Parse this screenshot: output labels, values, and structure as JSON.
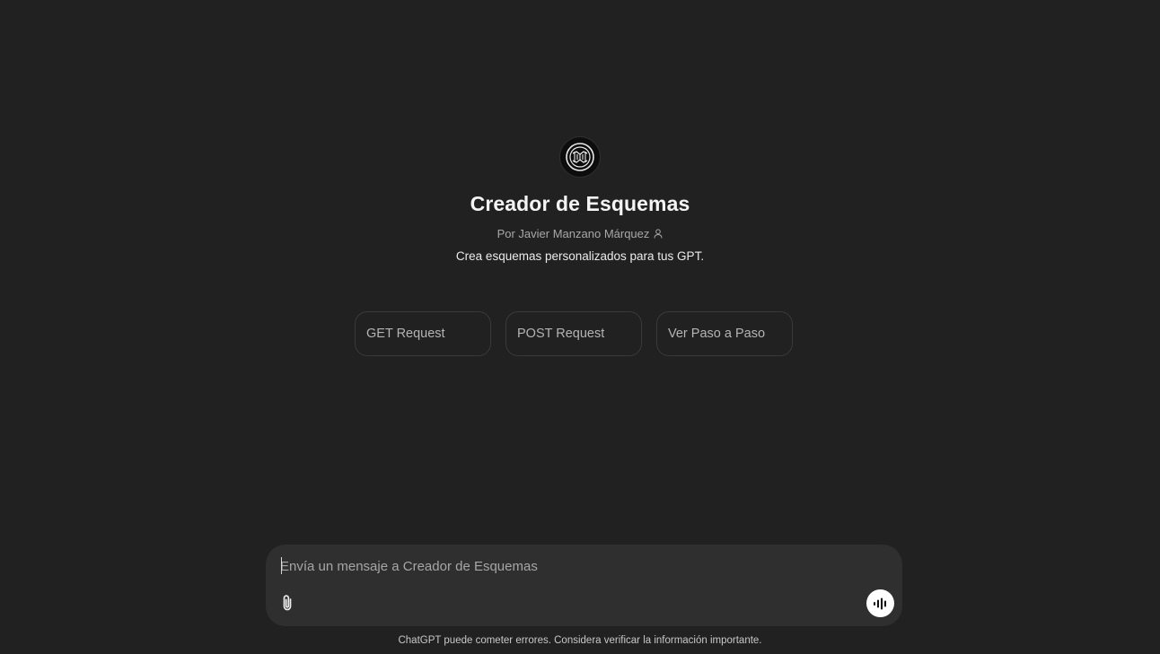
{
  "gpt": {
    "title": "Creador de Esquemas",
    "author": "Por Javier Manzano Márquez",
    "description": "Crea esquemas personalizados para tus GPT.",
    "avatar_icon": "maze-logo-icon"
  },
  "starters": [
    {
      "label": "GET Request"
    },
    {
      "label": "POST Request"
    },
    {
      "label": "Ver Paso a Paso"
    }
  ],
  "composer": {
    "placeholder": "Envía un mensaje a Creador de Esquemas",
    "value": "",
    "attach_icon": "paperclip-icon",
    "voice_icon": "voice-mode-icon"
  },
  "footer": {
    "note": "ChatGPT puede cometer errores. Considera verificar la información importante."
  },
  "colors": {
    "background": "#212121",
    "composer": "#2f2f2f",
    "starter_border": "#3a3a3a"
  }
}
